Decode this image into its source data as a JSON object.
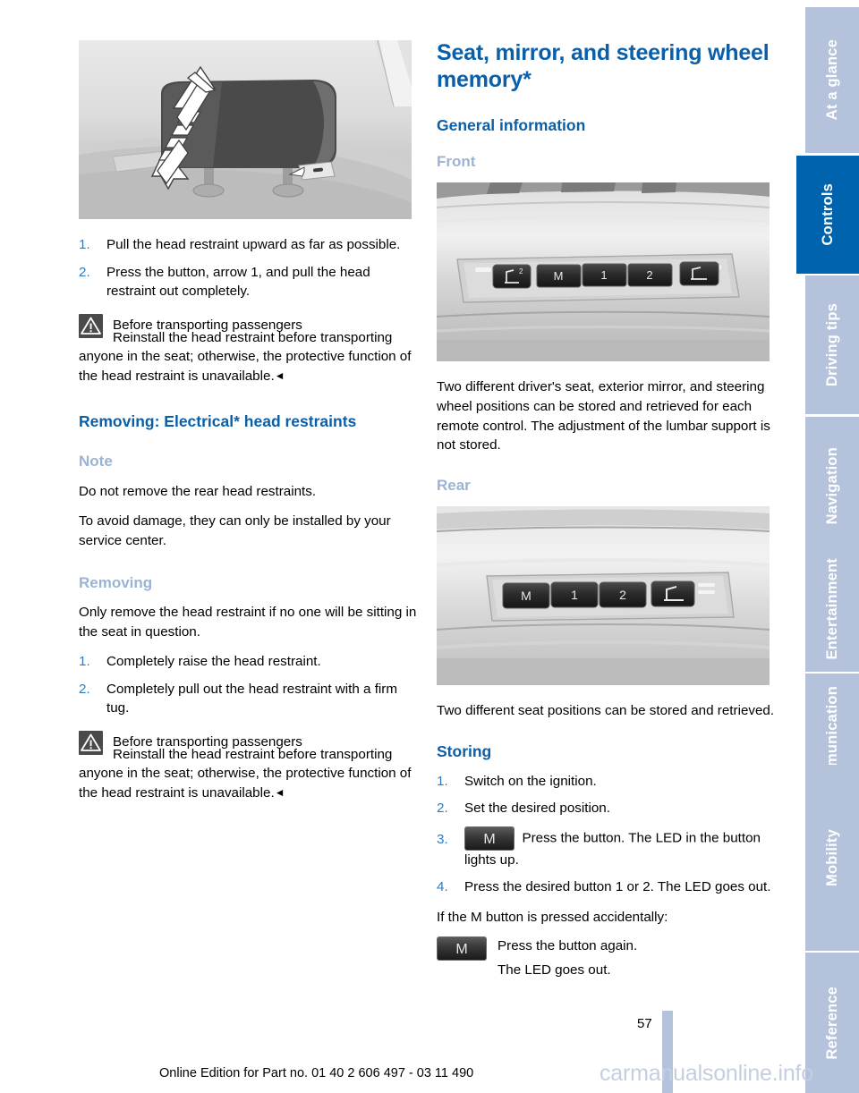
{
  "document": {
    "page_number": "57",
    "footer_note": "Online Edition for Part no. 01 40 2 606 497 - 03 11 490",
    "watermark": "carmanualsonline.info"
  },
  "colors": {
    "heading_blue": "#0a5fa8",
    "subheading_gray_blue": "#9bb3d4",
    "tab_inactive": "#b4c2dc",
    "tab_active": "#0063ae",
    "list_number_blue": "#2b7cc4"
  },
  "left_column": {
    "figure": {
      "name": "head-restraint-adjustment-illustration",
      "caption": "Head restraint with up/down arrow and release button arrow 1"
    },
    "steps_top": [
      {
        "num": "1.",
        "text": "Pull the head restraint upward as far as possible."
      },
      {
        "num": "2.",
        "text": "Press the button, arrow 1, and pull the head restraint out completely."
      }
    ],
    "warning_top": {
      "icon": "warning-triangle-icon",
      "heading": "Before transporting passengers",
      "body": "Reinstall the head restraint before transporting anyone in the seat; otherwise, the protective function of the head restraint is unavailable.",
      "end_mark": "◄"
    },
    "section_title": "Removing: Electrical* head restraints",
    "note_heading": "Note",
    "note_paragraphs": [
      "Do not remove the rear head restraints.",
      "To avoid damage, they can only be installed by your service center."
    ],
    "removing_heading": "Removing",
    "removing_intro": "Only remove the head restraint if no one will be sitting in the seat in question.",
    "steps_removing": [
      {
        "num": "1.",
        "text": "Completely raise the head restraint."
      },
      {
        "num": "2.",
        "text": "Completely pull out the head restraint with a firm tug."
      }
    ],
    "warning_bottom": {
      "icon": "warning-triangle-icon",
      "heading": "Before transporting passengers",
      "body": "Reinstall the head restraint before transporting anyone in the seat; otherwise, the protective function of the head restraint is unavailable.",
      "end_mark": "◄"
    }
  },
  "right_column": {
    "title": "Seat, mirror, and steering wheel memory*",
    "general_information_heading": "General information",
    "front_heading": "Front",
    "front_figure": {
      "name": "front-memory-panel-illustration",
      "buttons": [
        "seat-backrest-icon",
        "M",
        "1",
        "2",
        "seat-icon"
      ]
    },
    "front_paragraph": "Two different driver's seat, exterior mirror, and steering wheel positions can be stored and retrieved for each remote control. The adjustment of the lumbar support is not stored.",
    "rear_heading": "Rear",
    "rear_figure": {
      "name": "rear-memory-panel-illustration",
      "buttons": [
        "M",
        "1",
        "2",
        "seat-icon"
      ]
    },
    "rear_paragraph": "Two different seat positions can be stored and retrieved.",
    "storing_heading": "Storing",
    "storing_steps": [
      {
        "num": "1.",
        "text": "Switch on the ignition."
      },
      {
        "num": "2.",
        "text": "Set the desired position."
      },
      {
        "num": "3.",
        "glyph": "M",
        "text": "Press the button. The LED in the button lights up."
      },
      {
        "num": "4.",
        "text": "Press the desired button 1 or 2. The LED goes out."
      }
    ],
    "accidental_intro": "If the M button is pressed accidentally:",
    "accidental_rows": {
      "glyph": "M",
      "line1": "Press the button again.",
      "line2": "The LED goes out."
    }
  },
  "side_tabs": [
    {
      "label": "At a glance",
      "active": false
    },
    {
      "label": "Controls",
      "active": true
    },
    {
      "label": "Driving tips",
      "active": false
    },
    {
      "label": "Navigation",
      "active": false
    },
    {
      "label": "Entertainment",
      "active": false
    },
    {
      "label": "Communication",
      "active": false
    },
    {
      "label": "Mobility",
      "active": false
    },
    {
      "label": "Reference",
      "active": false
    }
  ]
}
